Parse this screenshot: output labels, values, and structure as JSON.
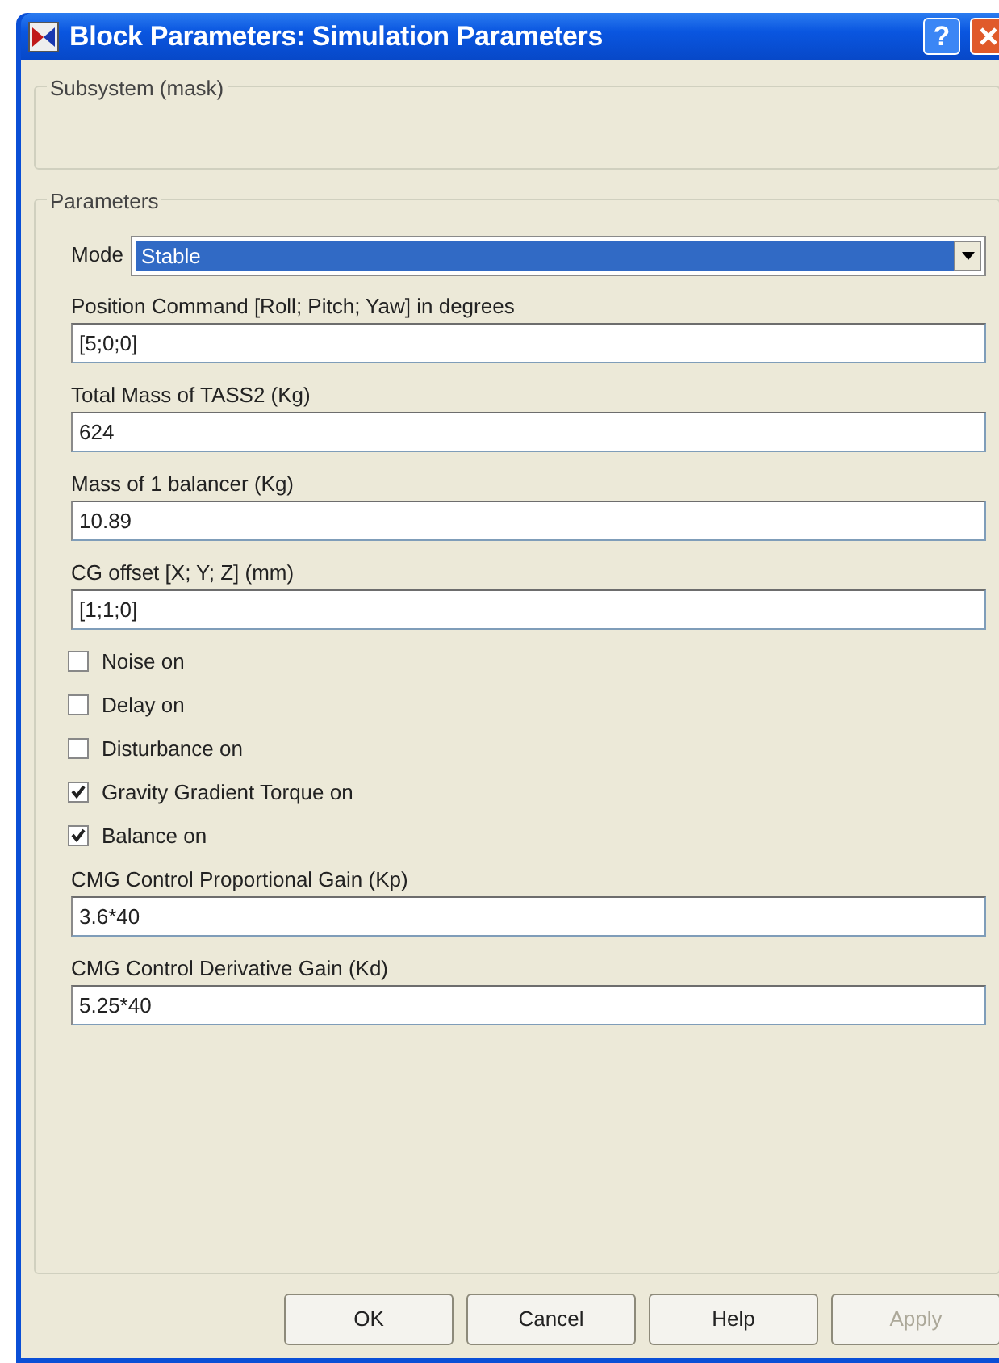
{
  "window": {
    "title": "Block Parameters: Simulation Parameters",
    "help_button": "?"
  },
  "subsystem": {
    "legend": "Subsystem (mask)"
  },
  "parameters": {
    "legend": "Parameters",
    "items": [
      {
        "kind": "popup",
        "label": "Mode",
        "value": "Stable",
        "selected": true
      },
      {
        "kind": "edit",
        "label": "Position Command [Roll; Pitch; Yaw] in degrees",
        "value": "[5;0;0]"
      },
      {
        "kind": "edit",
        "label": "Total Mass of TASS2 (Kg)",
        "value": "624"
      },
      {
        "kind": "edit",
        "label": "Mass of 1 balancer (Kg)",
        "value": "10.89"
      },
      {
        "kind": "edit",
        "label": "CG offset [X; Y; Z] (mm)",
        "value": "[1;1;0]"
      },
      {
        "kind": "checkbox",
        "label": "Noise on",
        "checked": false
      },
      {
        "kind": "checkbox",
        "label": "Delay on",
        "checked": false
      },
      {
        "kind": "checkbox",
        "label": "Disturbance on",
        "checked": false
      },
      {
        "kind": "checkbox",
        "label": "Gravity Gradient Torque on",
        "checked": true
      },
      {
        "kind": "checkbox",
        "label": "Balance on",
        "checked": true
      },
      {
        "kind": "edit",
        "label": "CMG Control Proportional Gain (Kp)",
        "value": "3.6*40"
      },
      {
        "kind": "edit",
        "label": "CMG Control Derivative Gain (Kd)",
        "value": "5.25*40"
      }
    ]
  },
  "buttons": [
    {
      "label": "OK",
      "disabled": false
    },
    {
      "label": "Cancel",
      "disabled": false
    },
    {
      "label": "Help",
      "disabled": false
    },
    {
      "label": "Apply",
      "disabled": true
    }
  ]
}
